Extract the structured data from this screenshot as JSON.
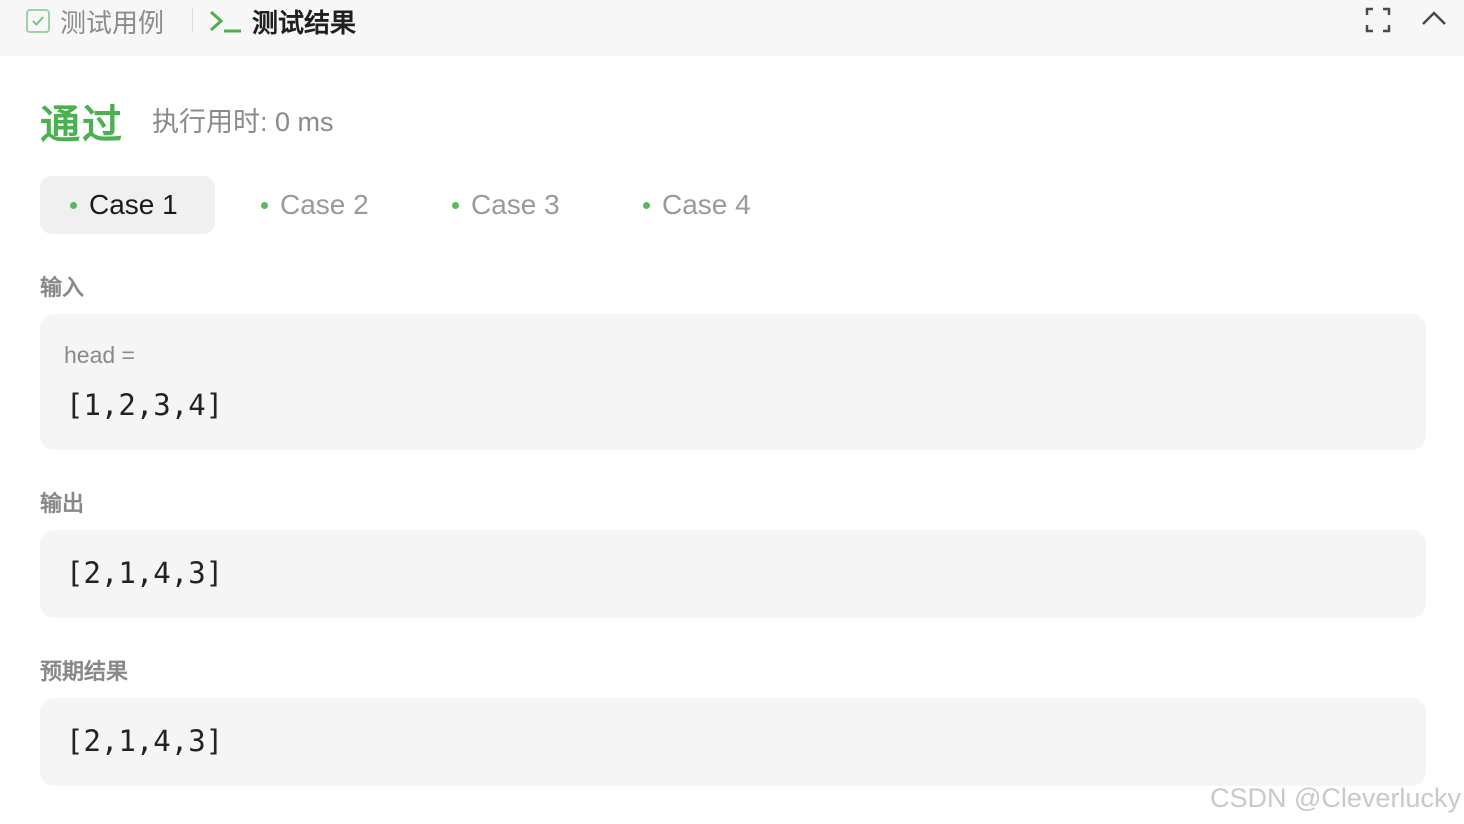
{
  "header": {
    "testcase_tab_label": "测试用例",
    "result_tab_label": "测试结果",
    "icons": [
      "check-square-icon",
      "terminal-prompt-icon",
      "expand-icon",
      "chevron-up-icon"
    ],
    "accent_color": "#4caf50"
  },
  "summary": {
    "status": "通过",
    "runtime": "执行用时: 0 ms"
  },
  "cases": [
    {
      "label": "Case 1",
      "active": true
    },
    {
      "label": "Case 2",
      "active": false
    },
    {
      "label": "Case 3",
      "active": false
    },
    {
      "label": "Case 4",
      "active": false
    }
  ],
  "input": {
    "label": "输入",
    "var_name": "head =",
    "value": "[1,2,3,4]"
  },
  "output": {
    "label": "输出",
    "value": "[2,1,4,3]"
  },
  "expected": {
    "label": "预期结果",
    "value": "[2,1,4,3]"
  },
  "watermark": "CSDN @Cleverlucky"
}
